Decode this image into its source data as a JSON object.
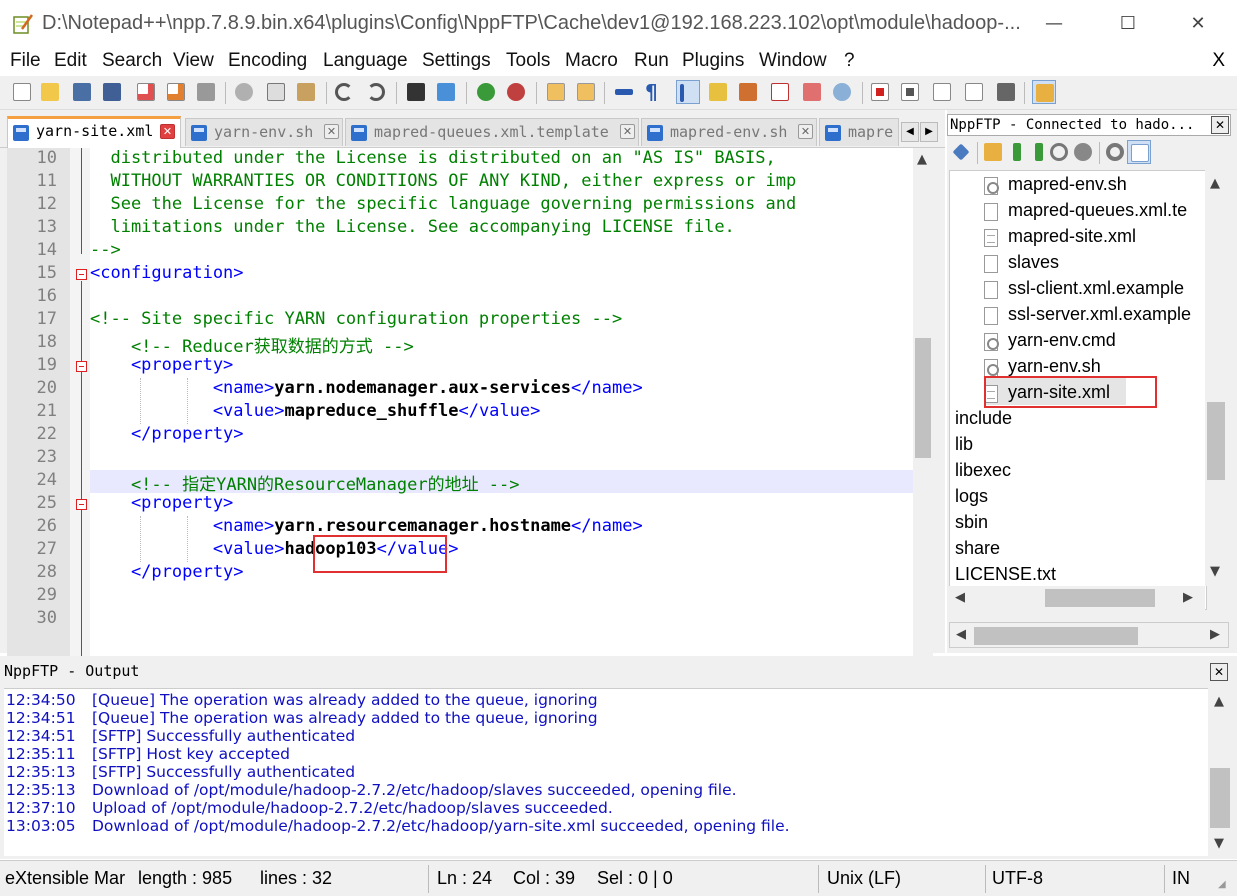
{
  "window": {
    "title": "D:\\Notepad++\\npp.7.8.9.bin.x64\\plugins\\Config\\NppFTP\\Cache\\dev1@192.168.223.102\\opt\\module\\hadoop-...",
    "minimize": "—",
    "maximize": "☐",
    "close": "✕"
  },
  "menu": {
    "items": [
      "File",
      "Edit",
      "Search",
      "View",
      "Encoding",
      "Language",
      "Settings",
      "Tools",
      "Macro",
      "Run",
      "Plugins",
      "Window",
      "?"
    ],
    "close_label": "X"
  },
  "tabs": [
    {
      "label": "yarn-site.xml",
      "active": true
    },
    {
      "label": "yarn-env.sh",
      "active": false
    },
    {
      "label": "mapred-queues.xml.template",
      "active": false
    },
    {
      "label": "mapred-env.sh",
      "active": false
    },
    {
      "label": "mapre",
      "active": false
    }
  ],
  "tab_close_glyph": "✕",
  "editor": {
    "lines": [
      {
        "n": "10",
        "segments": [
          {
            "t": "  distributed under the License is distributed on an \"AS IS\" BASIS,",
            "c": "com"
          }
        ]
      },
      {
        "n": "11",
        "segments": [
          {
            "t": "  WITHOUT WARRANTIES OR CONDITIONS OF ANY KIND, either express or imp",
            "c": "com"
          }
        ]
      },
      {
        "n": "12",
        "segments": [
          {
            "t": "  See the License for the specific language governing permissions and",
            "c": "com"
          }
        ]
      },
      {
        "n": "13",
        "segments": [
          {
            "t": "  limitations under the License. See accompanying LICENSE file.",
            "c": "com"
          }
        ]
      },
      {
        "n": "14",
        "segments": [
          {
            "t": "-->",
            "c": "com"
          }
        ]
      },
      {
        "n": "15",
        "segments": [
          {
            "t": "<configuration>",
            "c": "tag"
          }
        ]
      },
      {
        "n": "16",
        "segments": []
      },
      {
        "n": "17",
        "segments": [
          {
            "t": "<!-- Site specific YARN configuration properties -->",
            "c": "com"
          }
        ]
      },
      {
        "n": "18",
        "segments": [
          {
            "t": "    <!-- Reducer获取数据的方式 -->",
            "c": "com"
          }
        ]
      },
      {
        "n": "19",
        "segments": [
          {
            "t": "    <property>",
            "c": "tag"
          }
        ]
      },
      {
        "n": "20",
        "segments": [
          {
            "t": "            <name>",
            "c": "tag"
          },
          {
            "t": "yarn.nodemanager.aux-services",
            "c": "txt"
          },
          {
            "t": "</name>",
            "c": "tag"
          }
        ]
      },
      {
        "n": "21",
        "segments": [
          {
            "t": "            <value>",
            "c": "tag"
          },
          {
            "t": "mapreduce_shuffle",
            "c": "txt"
          },
          {
            "t": "</value>",
            "c": "tag"
          }
        ]
      },
      {
        "n": "22",
        "segments": [
          {
            "t": "    </property>",
            "c": "tag"
          }
        ]
      },
      {
        "n": "23",
        "segments": []
      },
      {
        "n": "24",
        "segments": [
          {
            "t": "    <!-- 指定YARN的ResourceManager的地址 -->",
            "c": "com"
          }
        ]
      },
      {
        "n": "25",
        "segments": [
          {
            "t": "    <property>",
            "c": "tag"
          }
        ]
      },
      {
        "n": "26",
        "segments": [
          {
            "t": "            <name>",
            "c": "tag"
          },
          {
            "t": "yarn.resourcemanager.hostname",
            "c": "txt"
          },
          {
            "t": "</name>",
            "c": "tag"
          }
        ]
      },
      {
        "n": "27",
        "segments": [
          {
            "t": "            <value>",
            "c": "tag"
          },
          {
            "t": "hadoop103",
            "c": "txt"
          },
          {
            "t": "</value>",
            "c": "tag"
          }
        ]
      },
      {
        "n": "28",
        "segments": [
          {
            "t": "    </property>",
            "c": "tag"
          }
        ]
      },
      {
        "n": "29",
        "segments": []
      },
      {
        "n": "30",
        "segments": []
      }
    ]
  },
  "ftp": {
    "title": "NppFTP - Connected to hado...",
    "close": "✕",
    "tree": [
      {
        "label": "mapred-env.sh",
        "icon": "gear",
        "indent": true
      },
      {
        "label": "mapred-queues.xml.te",
        "icon": "file",
        "indent": true
      },
      {
        "label": "mapred-site.xml",
        "icon": "doc",
        "indent": true
      },
      {
        "label": "slaves",
        "icon": "file",
        "indent": true
      },
      {
        "label": "ssl-client.xml.example",
        "icon": "file",
        "indent": true
      },
      {
        "label": "ssl-server.xml.example",
        "icon": "file",
        "indent": true
      },
      {
        "label": "yarn-env.cmd",
        "icon": "gear",
        "indent": true
      },
      {
        "label": "yarn-env.sh",
        "icon": "gear",
        "indent": true
      },
      {
        "label": "yarn-site.xml",
        "icon": "doc",
        "indent": true,
        "selected": true
      },
      {
        "label": "include",
        "icon": "",
        "indent": false
      },
      {
        "label": "lib",
        "icon": "",
        "indent": false
      },
      {
        "label": "libexec",
        "icon": "",
        "indent": false
      },
      {
        "label": "logs",
        "icon": "",
        "indent": false
      },
      {
        "label": "sbin",
        "icon": "",
        "indent": false
      },
      {
        "label": "share",
        "icon": "",
        "indent": false
      },
      {
        "label": "LICENSE.txt",
        "icon": "",
        "indent": false
      }
    ]
  },
  "output": {
    "title": "NppFTP - Output",
    "close": "✕",
    "lines": [
      {
        "time": "12:34:50",
        "msg": "[Queue] The operation was already added to the queue, ignoring"
      },
      {
        "time": "12:34:51",
        "msg": "[Queue] The operation was already added to the queue, ignoring"
      },
      {
        "time": "12:34:51",
        "msg": "[SFTP] Successfully authenticated"
      },
      {
        "time": "12:35:11",
        "msg": "[SFTP] Host key accepted"
      },
      {
        "time": "12:35:13",
        "msg": "[SFTP] Successfully authenticated"
      },
      {
        "time": "12:35:13",
        "msg": "Download of /opt/module/hadoop-2.7.2/etc/hadoop/slaves succeeded, opening file."
      },
      {
        "time": "12:37:10",
        "msg": "Upload of /opt/module/hadoop-2.7.2/etc/hadoop/slaves succeeded."
      },
      {
        "time": "13:03:05",
        "msg": "Download of /opt/module/hadoop-2.7.2/etc/hadoop/yarn-site.xml succeeded, opening file."
      }
    ]
  },
  "status": {
    "file_type": "eXtensible Mar",
    "length": "length : 985",
    "lines": "lines : 32",
    "ln": "Ln : 24",
    "col": "Col : 39",
    "sel": "Sel : 0 | 0",
    "eol": "Unix (LF)",
    "encoding": "UTF-8",
    "mode": "IN"
  },
  "colors": {
    "comment": "#008000",
    "tag": "#0000ff",
    "text": "#000000",
    "highlight_box": "#e03030",
    "log_text": "#1010c0"
  }
}
